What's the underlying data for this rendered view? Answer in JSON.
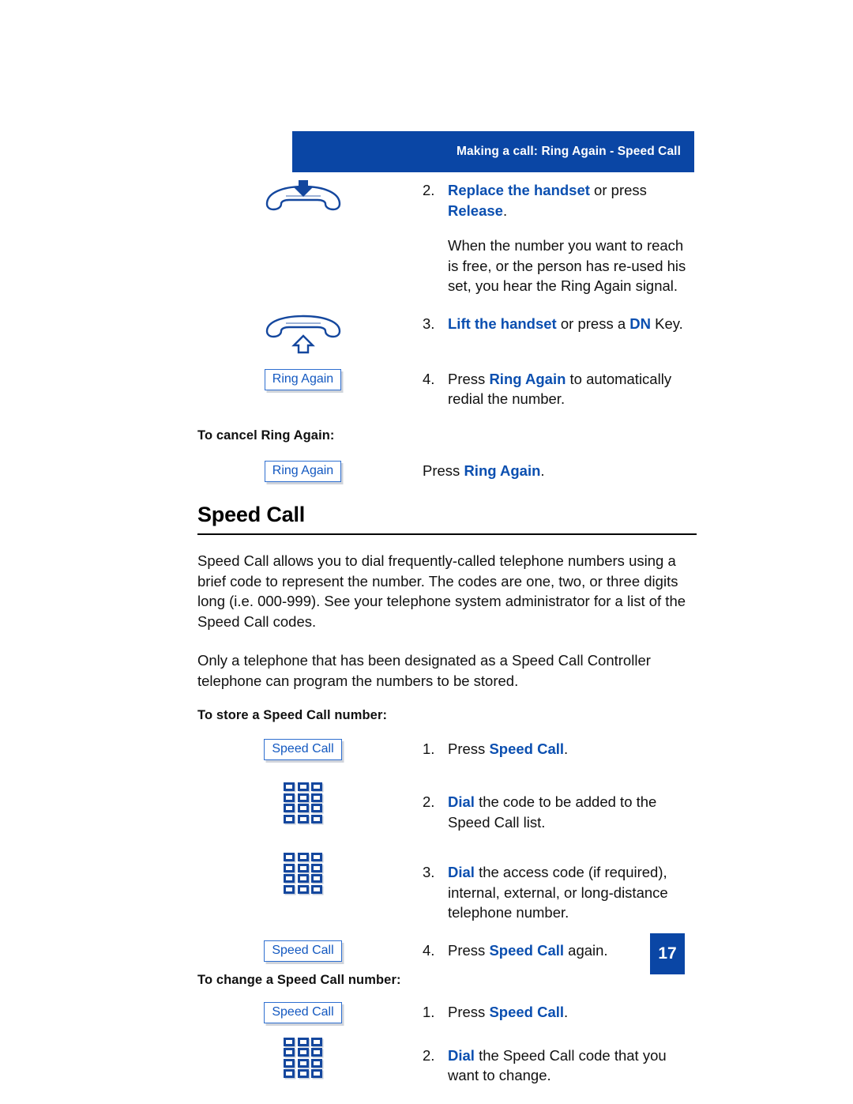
{
  "header": {
    "title": "Making a call: Ring Again - Speed Call",
    "bg_color": "#0a46a5",
    "text_color": "#ffffff"
  },
  "colors": {
    "accent_blue": "#0a46a5",
    "key_term_blue": "#0b4fb0",
    "softkey_border": "#2f6fd0",
    "softkey_text": "#1358c0",
    "body_text": "#111111"
  },
  "ring_again_section": {
    "steps": [
      {
        "number": "2.",
        "icon": "handset-replace-icon",
        "parts": [
          {
            "text": "Replace the handset",
            "bold": true
          },
          {
            "text": " or press ",
            "bold": false
          },
          {
            "text": "Release",
            "bold": true
          },
          {
            "text": ".",
            "bold": false
          }
        ]
      },
      {
        "number": "3.",
        "icon": "handset-lift-icon",
        "parts": [
          {
            "text": "Lift the handset",
            "bold": true
          },
          {
            "text": " or press a ",
            "bold": false
          },
          {
            "text": "DN",
            "bold": true
          },
          {
            "text": " Key.",
            "bold": false
          }
        ]
      },
      {
        "number": "4.",
        "icon": "softkey-ring-again",
        "icon_label": "Ring Again",
        "parts": [
          {
            "text": "Press ",
            "bold": false
          },
          {
            "text": "Ring Again",
            "bold": true
          },
          {
            "text": " to automatically redial the number.",
            "bold": false
          }
        ]
      }
    ],
    "note_paragraph": "When the number you want to reach is free, or the person has re-used his set, you hear the Ring Again signal.",
    "cancel_subhead": "To cancel Ring Again:",
    "cancel_step": {
      "icon": "softkey-ring-again",
      "icon_label": "Ring Again",
      "parts": [
        {
          "text": "Press ",
          "bold": false
        },
        {
          "text": "Ring Again",
          "bold": true
        },
        {
          "text": ".",
          "bold": false
        }
      ]
    }
  },
  "speed_call_section": {
    "heading": "Speed Call",
    "paragraphs": [
      "Speed Call allows you to dial frequently-called telephone numbers using a brief code to represent the number. The codes are one, two, or three digits long (i.e. 000-999). See your telephone system administrator for a list of the Speed Call codes.",
      "Only a telephone that has been designated as a Speed Call Controller telephone can program the numbers to be stored."
    ],
    "store_subhead": "To store a Speed Call number:",
    "store_steps": [
      {
        "number": "1.",
        "icon": "softkey-speed-call",
        "icon_label": "Speed Call",
        "parts": [
          {
            "text": "Press ",
            "bold": false
          },
          {
            "text": "Speed Call",
            "bold": true
          },
          {
            "text": ".",
            "bold": false
          }
        ]
      },
      {
        "number": "2.",
        "icon": "keypad-icon",
        "parts": [
          {
            "text": "Dial",
            "bold": true
          },
          {
            "text": " the code to be added to the Speed Call list.",
            "bold": false
          }
        ]
      },
      {
        "number": "3.",
        "icon": "keypad-icon",
        "parts": [
          {
            "text": "Dial",
            "bold": true
          },
          {
            "text": " the access code (if required), internal, external, or long-distance telephone number.",
            "bold": false
          }
        ]
      },
      {
        "number": "4.",
        "icon": "softkey-speed-call",
        "icon_label": "Speed Call",
        "parts": [
          {
            "text": "Press ",
            "bold": false
          },
          {
            "text": "Speed Call",
            "bold": true
          },
          {
            "text": " again.",
            "bold": false
          }
        ]
      }
    ],
    "change_subhead": "To change a Speed Call number:",
    "change_steps": [
      {
        "number": "1.",
        "icon": "softkey-speed-call",
        "icon_label": "Speed Call",
        "parts": [
          {
            "text": "Press ",
            "bold": false
          },
          {
            "text": "Speed Call",
            "bold": true
          },
          {
            "text": ".",
            "bold": false
          }
        ]
      },
      {
        "number": "2.",
        "icon": "keypad-icon",
        "parts": [
          {
            "text": "Dial",
            "bold": true
          },
          {
            "text": " the Speed Call code that you want to change.",
            "bold": false
          }
        ]
      }
    ]
  },
  "footer": {
    "page_number": "17"
  }
}
